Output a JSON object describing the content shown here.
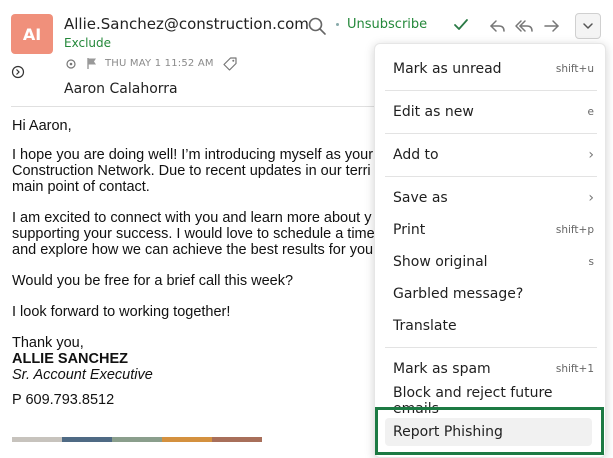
{
  "header": {
    "avatar_initials": "AI",
    "sender_email": "Allie.Sanchez@construction.com",
    "exclude_label": "Exclude",
    "unsubscribe_label": "Unsubscribe",
    "date": "THU MAY 1 11:52 AM",
    "recipient": "Aaron Calahorra"
  },
  "email": {
    "greeting": "Hi Aaron,",
    "para1": [
      "I hope you are doing well! I’m introducing myself as your",
      "Construction Network. Due to recent updates in our terri",
      "main point of contact."
    ],
    "para2": [
      "I am excited to connect with you and learn more about y",
      "supporting your success. I would love to schedule a time",
      "and explore how we can achieve the best results for you"
    ],
    "para3": "Would you be free for a brief call this week?",
    "para4": "I look forward to working together!",
    "closing": "Thank you,",
    "signature_name": "ALLIE SANCHEZ",
    "signature_title": "Sr. Account Executive",
    "phone_prefix": "P",
    "phone": "609.793.8512",
    "bar_colors": [
      "#c7c3bd",
      "#4f6a84",
      "#8a9e8c",
      "#d4913f",
      "#a86f5a"
    ]
  },
  "menu": {
    "mark_unread": "Mark as unread",
    "mark_unread_key": "shift+u",
    "edit_new": "Edit as new",
    "edit_new_key": "e",
    "add_to": "Add to",
    "save_as": "Save as",
    "print": "Print",
    "print_key": "shift+p",
    "show_original": "Show original",
    "show_original_key": "s",
    "garbled": "Garbled message?",
    "translate": "Translate",
    "mark_spam": "Mark as spam",
    "mark_spam_key": "shift+1",
    "block": "Block and reject future emails",
    "report_phishing": "Report Phishing"
  },
  "colors": {
    "accent_green": "#24883a",
    "avatar_bg": "#f0907b",
    "focus_border": "#1c7a43"
  },
  "icons": [
    "search-icon",
    "check-icon",
    "reply-icon",
    "reply-all-icon",
    "forward-icon",
    "chevron-down-icon",
    "expand-icon",
    "pin-icon",
    "flag-icon",
    "tag-icon"
  ]
}
